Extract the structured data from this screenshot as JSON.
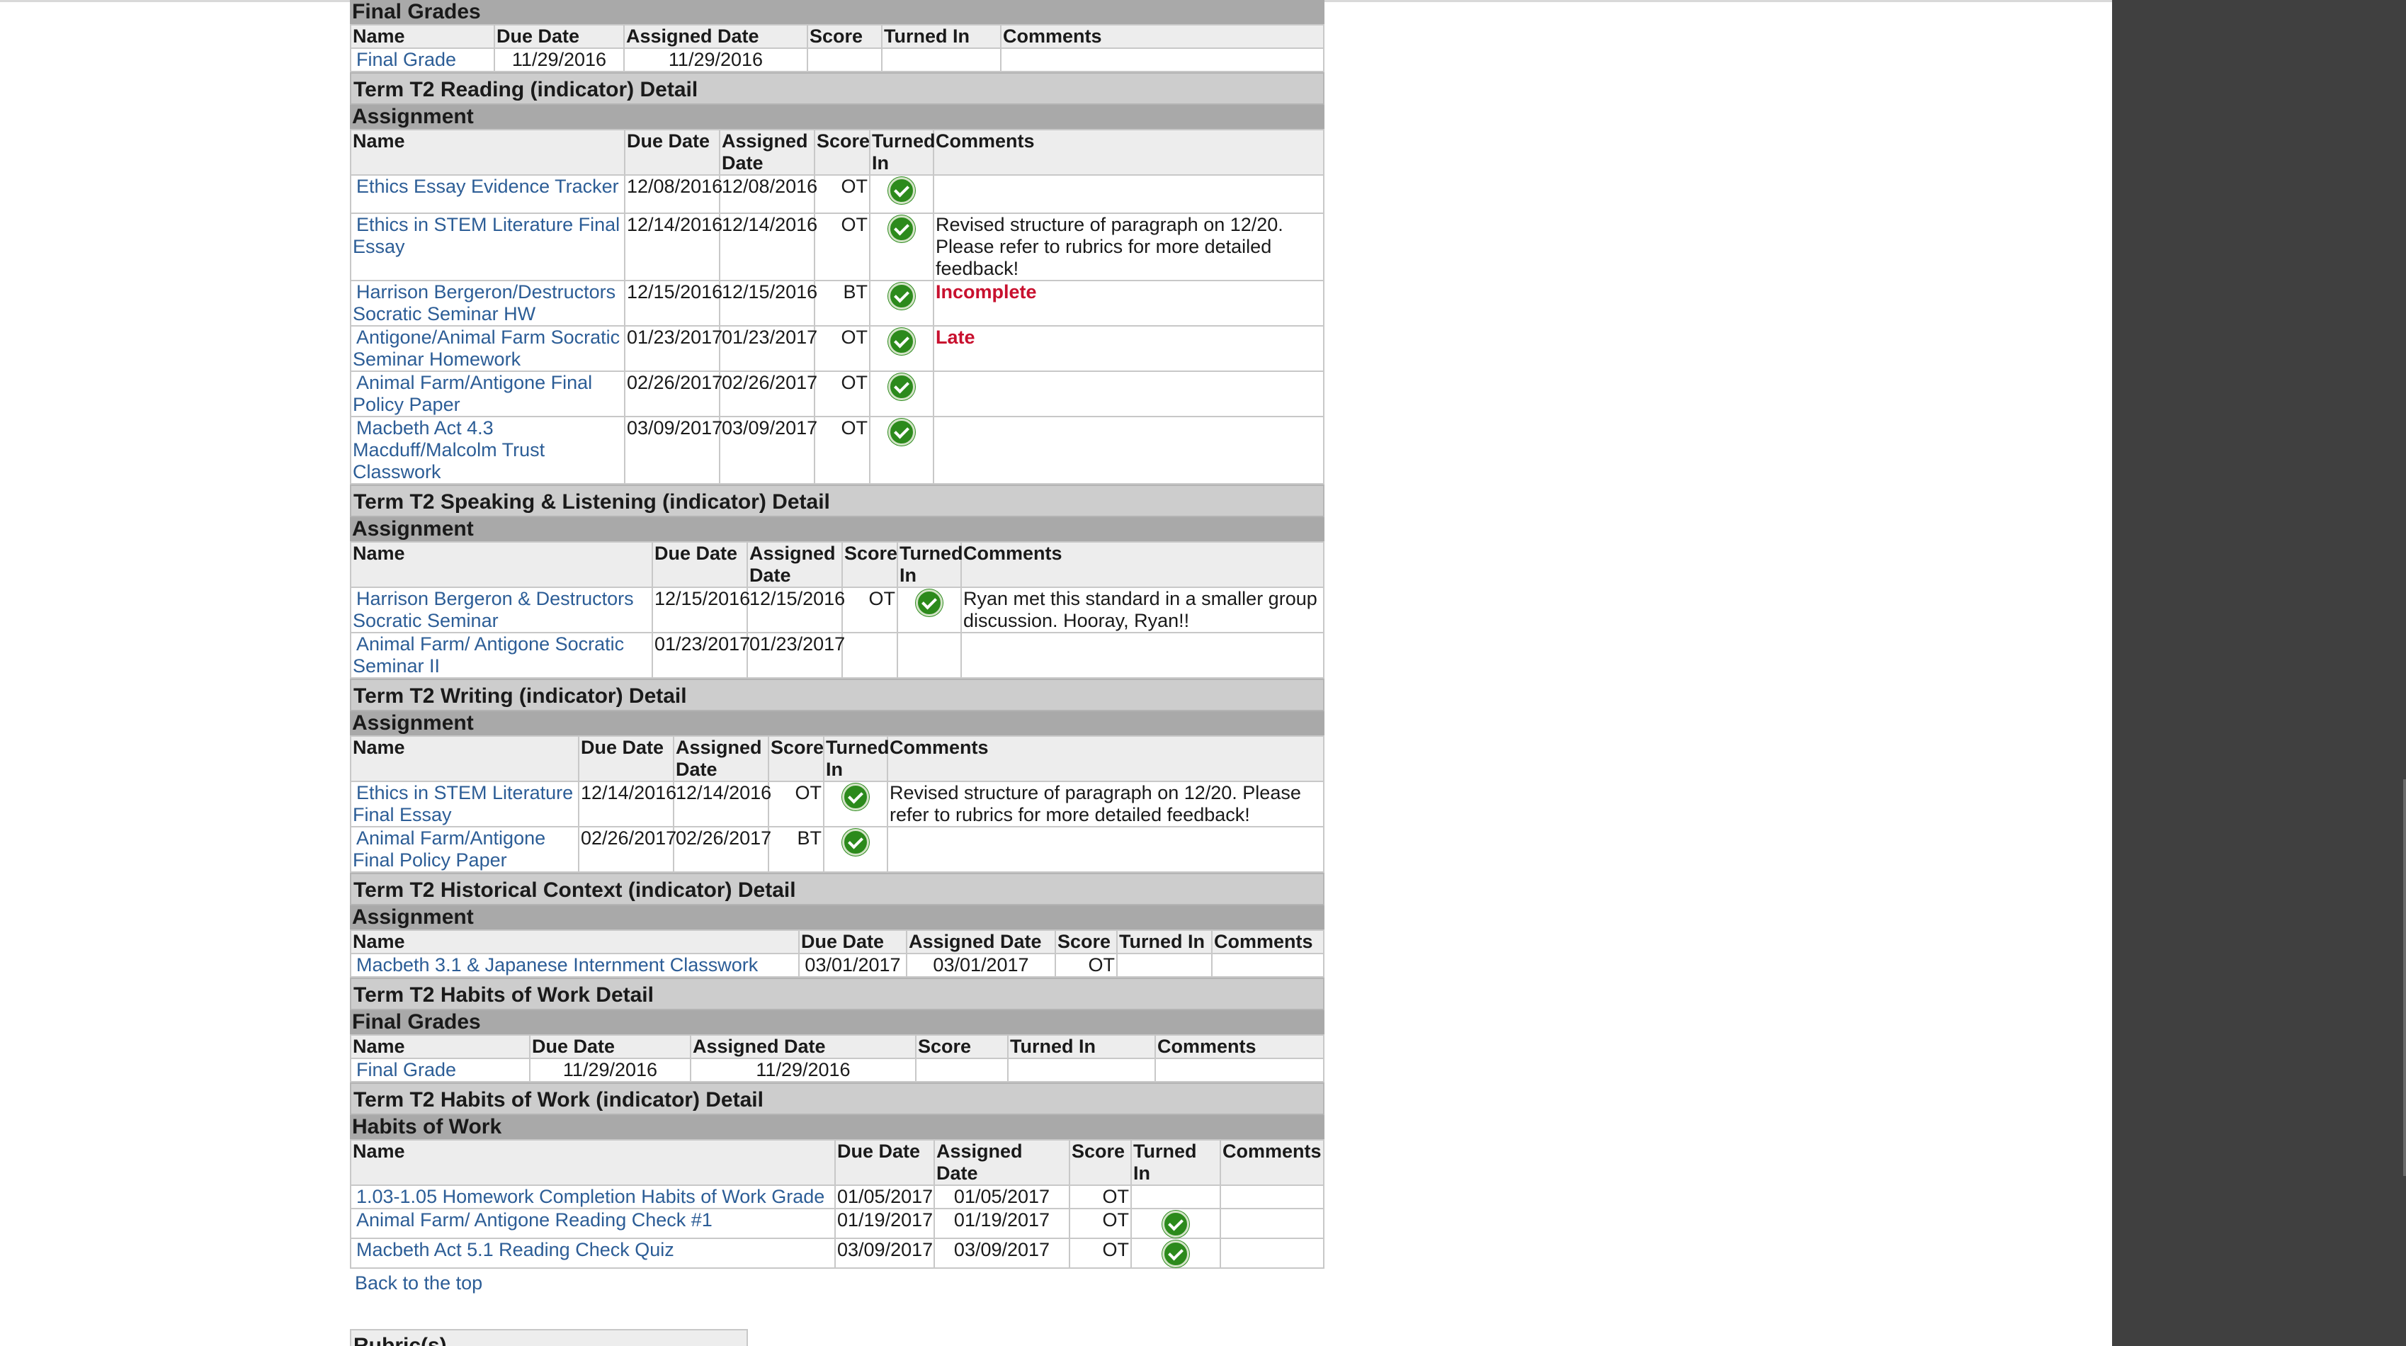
{
  "sections": {
    "final_grades_top": {
      "group": "Final Grades",
      "headers": [
        "Name",
        "Due Date",
        "Assigned Date",
        "Score",
        "Turned In",
        "Comments"
      ],
      "rows": [
        {
          "name": "Final Grade",
          "due": "11/29/2016",
          "assigned": "11/29/2016",
          "score": "",
          "comment": ""
        }
      ]
    },
    "reading": {
      "title": "Term T2 Reading (indicator) Detail",
      "group": "Assignment",
      "headers": [
        "Name",
        "Due Date",
        "Assigned Date",
        "Score",
        "Turned In",
        "Comments"
      ],
      "rows": [
        {
          "name": "Ethics Essay Evidence Tracker",
          "due": "12/08/2016",
          "assigned": "12/08/2016",
          "score": "OT",
          "comment": ""
        },
        {
          "name": "Ethics in STEM Literature Final Essay",
          "due": "12/14/2016",
          "assigned": "12/14/2016",
          "score": "OT",
          "comment": "Revised structure of paragraph on 12/20. Please refer to rubrics for more detailed feedback!"
        },
        {
          "name": "Harrison Bergeron/Destructors Socratic Seminar HW",
          "due": "12/15/2016",
          "assigned": "12/15/2016",
          "score": "BT",
          "comment": "Incomplete"
        },
        {
          "name": "Antigone/Animal Farm Socratic Seminar Homework",
          "due": "01/23/2017",
          "assigned": "01/23/2017",
          "score": "OT",
          "comment": "Late"
        },
        {
          "name": "Animal Farm/Antigone Final Policy Paper",
          "due": "02/26/2017",
          "assigned": "02/26/2017",
          "score": "OT",
          "comment": ""
        },
        {
          "name": "Macbeth Act 4.3 Macduff/Malcolm Trust Classwork",
          "due": "03/09/2017",
          "assigned": "03/09/2017",
          "score": "OT",
          "comment": ""
        }
      ]
    },
    "speaking": {
      "title": "Term T2 Speaking & Listening (indicator) Detail",
      "group": "Assignment",
      "headers": [
        "Name",
        "Due Date",
        "Assigned Date",
        "Score",
        "Turned In",
        "Comments"
      ],
      "rows": [
        {
          "name": "Harrison Bergeron & Destructors Socratic Seminar",
          "due": "12/15/2016",
          "assigned": "12/15/2016",
          "score": "OT",
          "comment": "Ryan met this standard in a smaller group discussion. Hooray, Ryan!!"
        },
        {
          "name": "Animal Farm/ Antigone Socratic Seminar II",
          "due": "01/23/2017",
          "assigned": "01/23/2017",
          "score": "",
          "comment": ""
        }
      ]
    },
    "writing": {
      "title": "Term T2 Writing (indicator) Detail",
      "group": "Assignment",
      "headers": [
        "Name",
        "Due Date",
        "Assigned Date",
        "Score",
        "Turned In",
        "Comments"
      ],
      "rows": [
        {
          "name": "Ethics in STEM Literature Final Essay",
          "due": "12/14/2016",
          "assigned": "12/14/2016",
          "score": "OT",
          "comment": "Revised structure of paragraph on 12/20. Please refer to rubrics for more detailed feedback!"
        },
        {
          "name": "Animal Farm/Antigone Final Policy Paper",
          "due": "02/26/2017",
          "assigned": "02/26/2017",
          "score": "BT",
          "comment": ""
        }
      ]
    },
    "historical": {
      "title": "Term T2 Historical Context (indicator) Detail",
      "group": "Assignment",
      "headers": [
        "Name",
        "Due Date",
        "Assigned Date",
        "Score",
        "Turned In",
        "Comments"
      ],
      "rows": [
        {
          "name": "Macbeth 3.1 & Japanese Internment Classwork",
          "due": "03/01/2017",
          "assigned": "03/01/2017",
          "score": "OT",
          "comment": ""
        }
      ]
    },
    "habits": {
      "title": "Term T2 Habits of Work Detail",
      "group": "Final Grades",
      "headers": [
        "Name",
        "Due Date",
        "Assigned Date",
        "Score",
        "Turned In",
        "Comments"
      ],
      "rows": [
        {
          "name": "Final Grade",
          "due": "11/29/2016",
          "assigned": "11/29/2016",
          "score": "",
          "comment": ""
        }
      ]
    },
    "habits_indicator": {
      "title": "Term T2 Habits of Work (indicator) Detail",
      "group": "Habits of Work",
      "headers": [
        "Name",
        "Due Date",
        "Assigned Date",
        "Score",
        "Turned In",
        "Comments"
      ],
      "rows": [
        {
          "name": "1.03-1.05 Homework Completion Habits of Work Grade",
          "due": "01/05/2017",
          "assigned": "01/05/2017",
          "score": "OT",
          "comment": ""
        },
        {
          "name": "Animal Farm/ Antigone Reading Check #1",
          "due": "01/19/2017",
          "assigned": "01/19/2017",
          "score": "OT",
          "comment": ""
        },
        {
          "name": "Macbeth Act 5.1 Reading Check Quiz",
          "due": "03/09/2017",
          "assigned": "03/09/2017",
          "score": "OT",
          "comment": ""
        }
      ]
    }
  },
  "back_to_top": "Back to the top",
  "rubric_heading": "Rubric(s)",
  "colors": {
    "link": "#2c5d96",
    "flag": "#c8102e",
    "check": "#2c8a1c",
    "section_header": "#cdcdcd",
    "group_header": "#a9a9a9"
  }
}
